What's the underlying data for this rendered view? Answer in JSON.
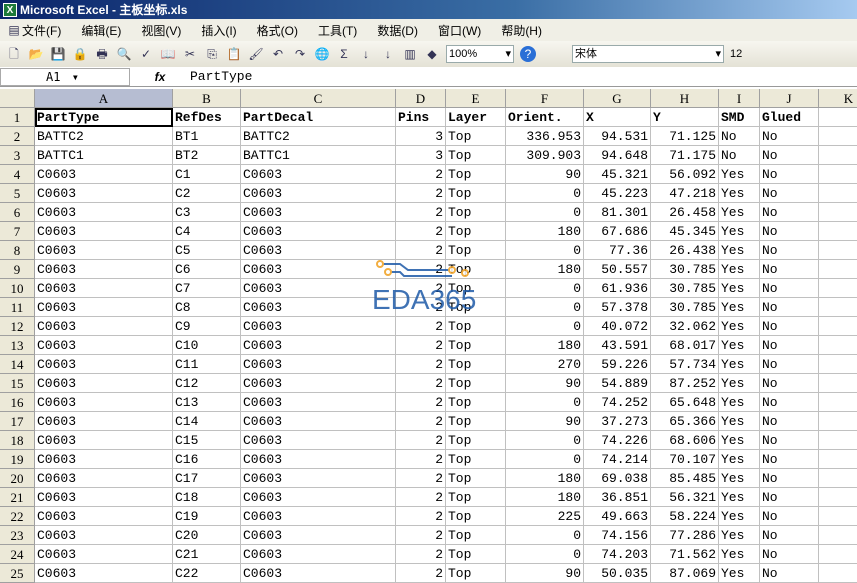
{
  "window": {
    "title": "Microsoft Excel - 主板坐标.xls"
  },
  "menu": [
    "文件(F)",
    "编辑(E)",
    "视图(V)",
    "插入(I)",
    "格式(O)",
    "工具(T)",
    "数据(D)",
    "窗口(W)",
    "帮助(H)"
  ],
  "toolbar": {
    "zoom": "100%",
    "font": "宋体",
    "font_size": "12"
  },
  "formula_bar": {
    "name_box": "A1",
    "fx": "fx",
    "value": "PartType"
  },
  "columns": [
    "A",
    "B",
    "C",
    "D",
    "E",
    "F",
    "G",
    "H",
    "I",
    "J",
    "K"
  ],
  "header": [
    "PartType",
    "RefDes",
    "PartDecal",
    "Pins",
    "Layer",
    "Orient.",
    "X",
    "Y",
    "SMD",
    "Glued"
  ],
  "rows": [
    [
      "BATTC2",
      "BT1",
      "BATTC2",
      "3",
      "Top",
      "336.953",
      "94.531",
      "71.125",
      "No",
      "No"
    ],
    [
      "BATTC1",
      "BT2",
      "BATTC1",
      "3",
      "Top",
      "309.903",
      "94.648",
      "71.175",
      "No",
      "No"
    ],
    [
      "C0603",
      "C1",
      "C0603",
      "2",
      "Top",
      "90",
      "45.321",
      "56.092",
      "Yes",
      "No"
    ],
    [
      "C0603",
      "C2",
      "C0603",
      "2",
      "Top",
      "0",
      "45.223",
      "47.218",
      "Yes",
      "No"
    ],
    [
      "C0603",
      "C3",
      "C0603",
      "2",
      "Top",
      "0",
      "81.301",
      "26.458",
      "Yes",
      "No"
    ],
    [
      "C0603",
      "C4",
      "C0603",
      "2",
      "Top",
      "180",
      "67.686",
      "45.345",
      "Yes",
      "No"
    ],
    [
      "C0603",
      "C5",
      "C0603",
      "2",
      "Top",
      "0",
      "77.36",
      "26.438",
      "Yes",
      "No"
    ],
    [
      "C0603",
      "C6",
      "C0603",
      "2",
      "Top",
      "180",
      "50.557",
      "30.785",
      "Yes",
      "No"
    ],
    [
      "C0603",
      "C7",
      "C0603",
      "2",
      "Top",
      "0",
      "61.936",
      "30.785",
      "Yes",
      "No"
    ],
    [
      "C0603",
      "C8",
      "C0603",
      "2",
      "Top",
      "0",
      "57.378",
      "30.785",
      "Yes",
      "No"
    ],
    [
      "C0603",
      "C9",
      "C0603",
      "2",
      "Top",
      "0",
      "40.072",
      "32.062",
      "Yes",
      "No"
    ],
    [
      "C0603",
      "C10",
      "C0603",
      "2",
      "Top",
      "180",
      "43.591",
      "68.017",
      "Yes",
      "No"
    ],
    [
      "C0603",
      "C11",
      "C0603",
      "2",
      "Top",
      "270",
      "59.226",
      "57.734",
      "Yes",
      "No"
    ],
    [
      "C0603",
      "C12",
      "C0603",
      "2",
      "Top",
      "90",
      "54.889",
      "87.252",
      "Yes",
      "No"
    ],
    [
      "C0603",
      "C13",
      "C0603",
      "2",
      "Top",
      "0",
      "74.252",
      "65.648",
      "Yes",
      "No"
    ],
    [
      "C0603",
      "C14",
      "C0603",
      "2",
      "Top",
      "90",
      "37.273",
      "65.366",
      "Yes",
      "No"
    ],
    [
      "C0603",
      "C15",
      "C0603",
      "2",
      "Top",
      "0",
      "74.226",
      "68.606",
      "Yes",
      "No"
    ],
    [
      "C0603",
      "C16",
      "C0603",
      "2",
      "Top",
      "0",
      "74.214",
      "70.107",
      "Yes",
      "No"
    ],
    [
      "C0603",
      "C17",
      "C0603",
      "2",
      "Top",
      "180",
      "69.038",
      "85.485",
      "Yes",
      "No"
    ],
    [
      "C0603",
      "C18",
      "C0603",
      "2",
      "Top",
      "180",
      "36.851",
      "56.321",
      "Yes",
      "No"
    ],
    [
      "C0603",
      "C19",
      "C0603",
      "2",
      "Top",
      "225",
      "49.663",
      "58.224",
      "Yes",
      "No"
    ],
    [
      "C0603",
      "C20",
      "C0603",
      "2",
      "Top",
      "0",
      "74.156",
      "77.286",
      "Yes",
      "No"
    ],
    [
      "C0603",
      "C21",
      "C0603",
      "2",
      "Top",
      "0",
      "74.203",
      "71.562",
      "Yes",
      "No"
    ],
    [
      "C0603",
      "C22",
      "C0603",
      "2",
      "Top",
      "90",
      "50.035",
      "87.069",
      "Yes",
      "No"
    ]
  ],
  "watermark": "EDA365"
}
